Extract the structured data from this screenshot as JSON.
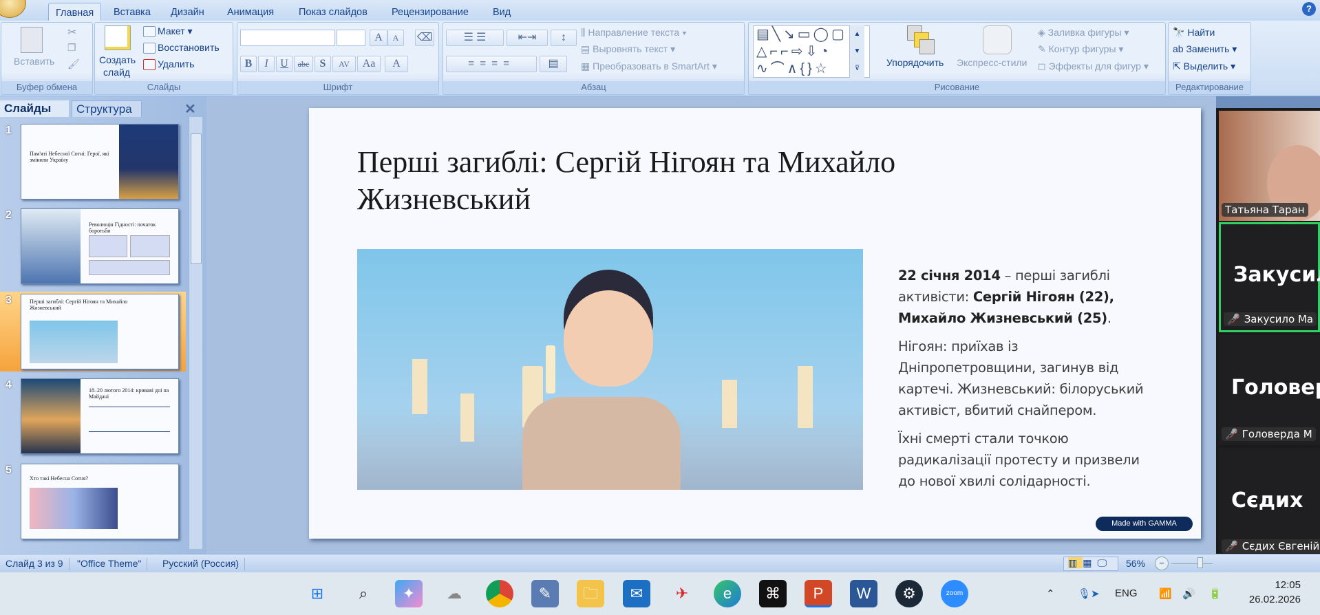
{
  "ribbon": {
    "tabs": [
      "Главная",
      "Вставка",
      "Дизайн",
      "Анимация",
      "Показ слайдов",
      "Рецензирование",
      "Вид"
    ],
    "clipboard": {
      "paste": "Вставить",
      "label": "Буфер обмена"
    },
    "slides": {
      "new_slide": "Создать",
      "new_slide2": "слайд",
      "layout": "Макет",
      "reset": "Восстановить",
      "delete": "Удалить",
      "label": "Слайды"
    },
    "font": {
      "bold": "B",
      "italic": "I",
      "underline": "U",
      "strike": "abc",
      "shadow": "S",
      "spacing": "AV",
      "case": "Aa",
      "color": "A",
      "grow": "A",
      "shrink": "A",
      "label": "Шрифт"
    },
    "paragraph": {
      "text_direction": "Направление текста",
      "align_text": "Выровнять текст",
      "smartart": "Преобразовать в SmartArt",
      "label": "Абзац"
    },
    "drawing": {
      "arrange": "Упорядочить",
      "quick_styles": "Экспресс-стили",
      "fill": "Заливка фигуры",
      "outline": "Контур фигуры",
      "effects": "Эффекты для фигур",
      "label": "Рисование"
    },
    "editing": {
      "find": "Найти",
      "replace": "Заменить",
      "select": "Выделить",
      "label": "Редактирование"
    }
  },
  "panel": {
    "tab_slides": "Слайды",
    "tab_outline": "Структура",
    "thumbs": [
      {
        "num": "1",
        "title": "Пам'яті Небесної Сотні: Герої, які змінили Україну"
      },
      {
        "num": "2",
        "title": "Революція Гідності: початок боротьби"
      },
      {
        "num": "3",
        "title": "Перші загиблі: Сергій Нігоян та Михайло Жизневський"
      },
      {
        "num": "4",
        "title": "18–20 лютого 2014: криваві дні на Майдані"
      },
      {
        "num": "5",
        "title": "Хто такі Небесна Сотня?"
      }
    ]
  },
  "slide": {
    "title": "Перші загиблі: Сергій Нігоян та Михайло Жизневський",
    "p1_bold": "22 січня 2014",
    "p1_text": " – перші загиблі активісти: ",
    "p1_names": "Сергій Нігоян (22), Михайло Жизневський (25)",
    "p1_end": ".",
    "p2": "Нігоян: приїхав із Дніпропетровщини, загинув від картечі. Жизневський: білоруський активіст, вбитий снайпером.",
    "p3": "Їхні смерті стали точкою радикалізації протесту и призвели до нової хвилі солідарності.",
    "badge": "Made with GAMMA"
  },
  "zoom": {
    "participants": [
      {
        "big": "",
        "name": "Татьяна Таран",
        "video": true
      },
      {
        "big": "Закусило",
        "name": "Закусило Ма",
        "active": true
      },
      {
        "big": "Головерда",
        "name": "Головерда М"
      },
      {
        "big": "Сєдих",
        "name": "Сєдих Євгеній"
      }
    ]
  },
  "status": {
    "slide": "Слайд 3 из 9",
    "theme": "\"Office Theme\"",
    "lang": "Русский (Россия)",
    "zoom": "56%",
    "zoom_value": 56
  },
  "taskbar": {
    "icons": [
      "windows-start",
      "search",
      "copilot",
      "cloud-app",
      "chrome",
      "paint",
      "file-explorer",
      "mail",
      "game-app",
      "edge",
      "capcut",
      "powerpoint",
      "word",
      "steam",
      "zoom"
    ],
    "zoom_label": "zoom",
    "lang": "ENG",
    "time": "12:05",
    "date": "26.02.2026"
  }
}
